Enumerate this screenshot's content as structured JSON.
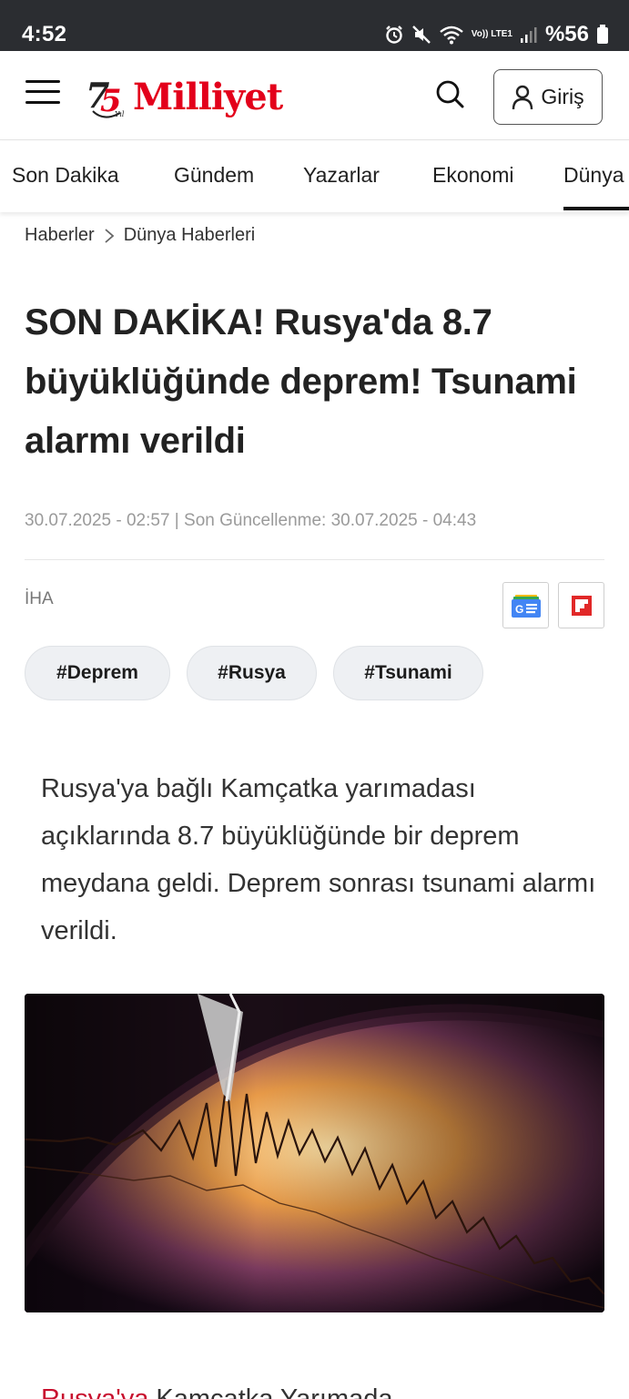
{
  "status_bar": {
    "time": "4:52",
    "network_lte": "Vo)) LTE1",
    "battery": "%56",
    "icons": [
      "alarm-icon",
      "mute-icon",
      "wifi-icon",
      "signal-icon",
      "battery-icon"
    ]
  },
  "header": {
    "logo_mark": "75 Yıl",
    "logo_text": "Milliyet",
    "login_label": "Giriş",
    "brand_color": "#e3001b"
  },
  "nav": {
    "tabs": [
      "Son Dakika",
      "Gündem",
      "Yazarlar",
      "Ekonomi",
      "Dünya"
    ],
    "active": "Dünya"
  },
  "breadcrumb": {
    "items": [
      "Haberler",
      "Dünya Haberleri"
    ]
  },
  "article": {
    "title": "SON DAKİKA! Rusya'da 8.7 büyüklüğünde deprem! Tsunami alarmı verildi",
    "dateline": "30.07.2025 - 02:57 | Son Güncellenme: 30.07.2025 - 04:43",
    "source": "İHA",
    "share": [
      "google-news-icon",
      "flipboard-icon"
    ],
    "tags": [
      "#Deprem",
      "#Rusya",
      "#Tsunami"
    ],
    "lead": "Rusya'ya bağlı Kamçatka yarımadası açıklarında 8.7 büyüklüğünde bir deprem meydana geldi. Deprem sonrası tsunami alarmı verildi.",
    "image_alt": "seismograph-image",
    "next_line_red": "Rusya'ya",
    "next_line_rest": " Kamçatka Yarımada"
  }
}
